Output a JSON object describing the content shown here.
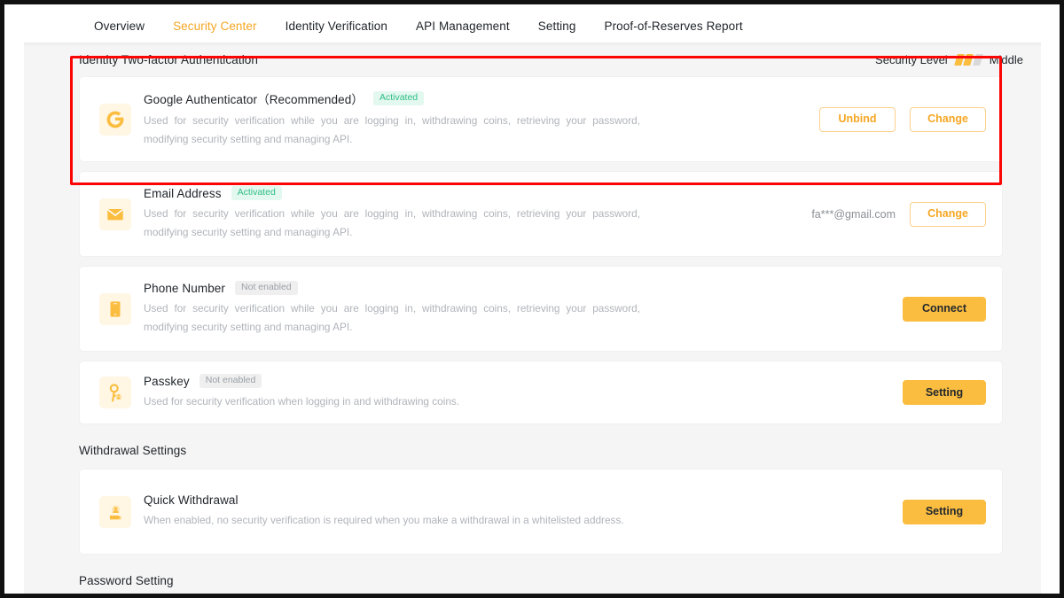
{
  "nav": {
    "tabs": [
      {
        "label": "Overview",
        "active": false
      },
      {
        "label": "Security Center",
        "active": true
      },
      {
        "label": "Identity Verification",
        "active": false
      },
      {
        "label": "API Management",
        "active": false
      },
      {
        "label": "Setting",
        "active": false
      },
      {
        "label": "Proof-of-Reserves Report",
        "active": false
      }
    ]
  },
  "colors": {
    "accent": "#f5a623",
    "solid_button": "#fbbd3f",
    "badge_on_bg": "#e3f8ef",
    "badge_on_text": "#2ebd85",
    "badge_off_bg": "#efefef",
    "badge_off_text": "#9aa0a6",
    "highlight_box": "#fb0505",
    "page_bg": "#f5f5f5"
  },
  "section_2fa": {
    "title": "Identity Two-factor Authentication",
    "security_level_label": "Security Level",
    "security_level_value": "Middle",
    "security_level_filled": 2,
    "security_level_total": 3,
    "rows": [
      {
        "icon": "google-authenticator-icon",
        "title": "Google Authenticator（Recommended）",
        "badge": "Activated",
        "badge_state": "on",
        "description": "Used for security verification while you are logging in, withdrawing coins, retrieving your password, modifying security setting and managing API.",
        "value": "",
        "buttons": [
          {
            "label": "Unbind",
            "style": "ghost"
          },
          {
            "label": "Change",
            "style": "ghost"
          }
        ]
      },
      {
        "icon": "email-icon",
        "title": "Email Address",
        "badge": "Activated",
        "badge_state": "on",
        "description": "Used for security verification while you are logging in, withdrawing coins, retrieving your password, modifying security setting and managing API.",
        "value": "fa***@gmail.com",
        "buttons": [
          {
            "label": "Change",
            "style": "ghost"
          }
        ]
      },
      {
        "icon": "phone-icon",
        "title": "Phone Number",
        "badge": "Not enabled",
        "badge_state": "off",
        "description": "Used for security verification while you are logging in, withdrawing coins, retrieving your password, modifying security setting and managing API.",
        "value": "",
        "buttons": [
          {
            "label": "Connect",
            "style": "solid"
          }
        ]
      },
      {
        "icon": "passkey-icon",
        "title": "Passkey",
        "badge": "Not enabled",
        "badge_state": "off",
        "description": "Used for security verification when logging in and withdrawing coins.",
        "value": "",
        "buttons": [
          {
            "label": "Setting",
            "style": "solid"
          }
        ]
      }
    ]
  },
  "section_withdrawal": {
    "title": "Withdrawal Settings",
    "rows": [
      {
        "icon": "quick-withdrawal-icon",
        "title": "Quick Withdrawal",
        "badge": "",
        "badge_state": "",
        "description": "When enabled, no security verification is required when you make a withdrawal in a whitelisted address.",
        "value": "",
        "buttons": [
          {
            "label": "Setting",
            "style": "solid"
          }
        ]
      }
    ]
  },
  "section_password": {
    "title": "Password Setting"
  }
}
